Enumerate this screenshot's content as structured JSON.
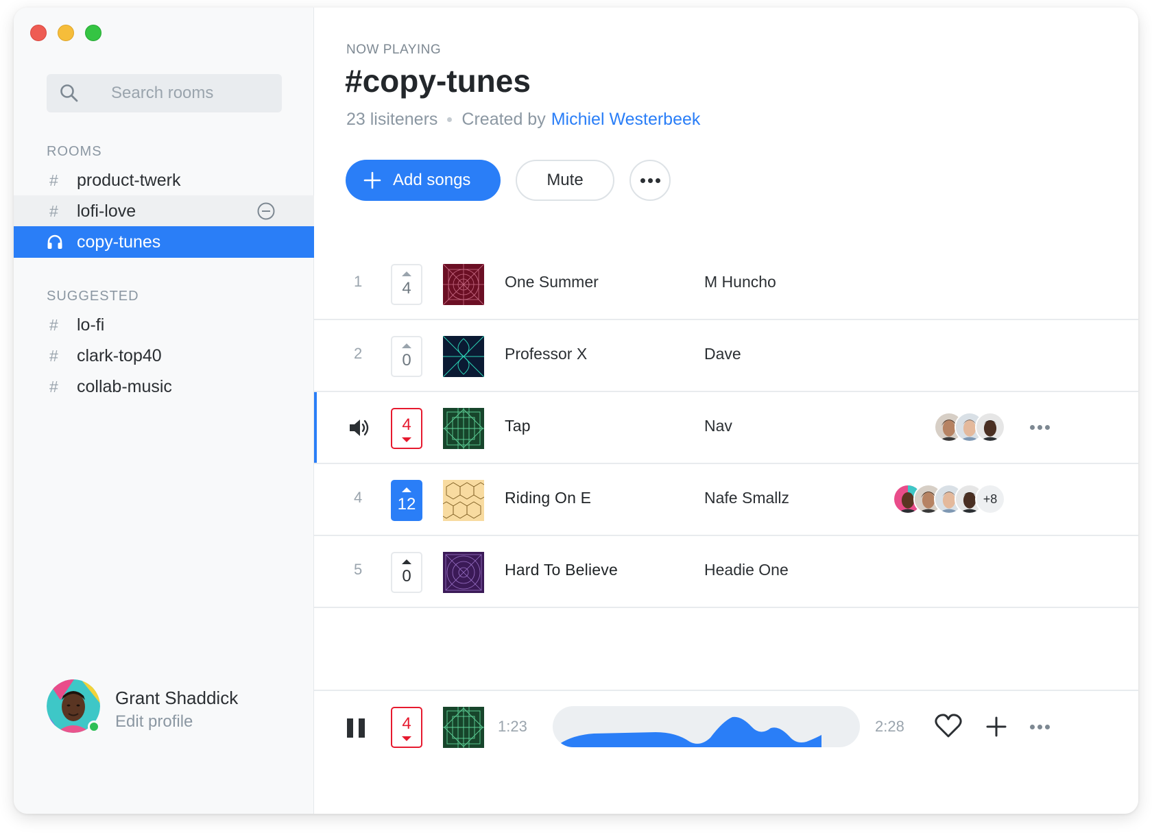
{
  "window": {
    "controls": [
      "close",
      "minimize",
      "zoom"
    ]
  },
  "sidebar": {
    "search": {
      "placeholder": "Search rooms",
      "icon": "search-icon"
    },
    "rooms_label": "ROOMS",
    "rooms": [
      {
        "name": "product-twerk",
        "icon": "hash"
      },
      {
        "name": "lofi-love",
        "icon": "hash",
        "state": "hover"
      },
      {
        "name": "copy-tunes",
        "icon": "headphones",
        "state": "active"
      }
    ],
    "suggested_label": "SUGGESTED",
    "suggested": [
      {
        "name": "lo-fi"
      },
      {
        "name": "clark-top40"
      },
      {
        "name": "collab-music"
      }
    ],
    "hash_symbol": "#",
    "profile": {
      "name": "Grant Shaddick",
      "link": "Edit profile",
      "status": "online"
    }
  },
  "header": {
    "kicker": "NOW PLAYING",
    "title": "#copy-tunes",
    "listeners": "23 lisiteners",
    "created_by": "Created by",
    "creator": "Michiel Westerbeek",
    "add_songs": "Add songs",
    "mute": "Mute"
  },
  "tracks": [
    {
      "index": "1",
      "votes": "4",
      "vote_state": "none",
      "title": "One Summer",
      "artist": "M Huncho",
      "art_color": "#6b0f24"
    },
    {
      "index": "2",
      "votes": "0",
      "vote_state": "none",
      "title": "Professor X",
      "artist": "Dave",
      "art_color": "#0b1a33"
    },
    {
      "index": "",
      "votes": "4",
      "vote_state": "down",
      "title": "Tap",
      "artist": "Nav",
      "art_color": "#17452b",
      "playing": true,
      "listeners": 3
    },
    {
      "index": "4",
      "votes": "12",
      "vote_state": "up",
      "title": "Riding On E",
      "artist": "Nafe Smallz",
      "art_color": "#f8dba0",
      "listeners": 4,
      "extra_listeners": "+8"
    },
    {
      "index": "5",
      "votes": "0",
      "vote_state": "none",
      "title": "Hard To Believe",
      "artist": "Headie One",
      "art_color": "#3b1a57"
    }
  ],
  "player": {
    "votes": "4",
    "elapsed": "1:23",
    "duration": "2:28",
    "progress": 0.88,
    "accent": "#2a7ef7"
  },
  "colors": {
    "accent": "#2a7ef7",
    "downvote": "#e6192e",
    "online": "#2fbf56"
  }
}
